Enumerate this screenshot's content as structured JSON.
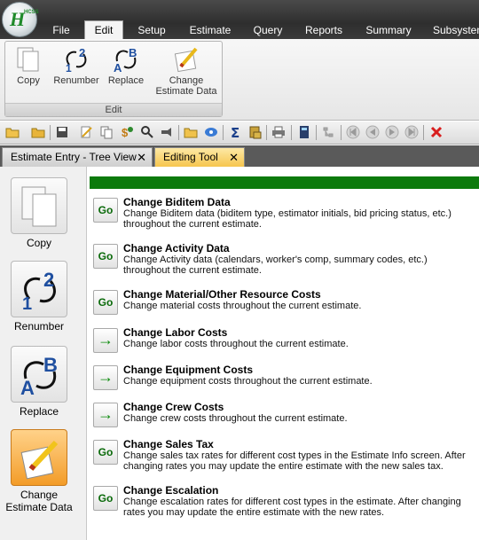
{
  "app": {
    "logo_text": "HCSS"
  },
  "menu": {
    "tabs": [
      {
        "label": "File"
      },
      {
        "label": "Edit"
      },
      {
        "label": "Setup"
      },
      {
        "label": "Estimate"
      },
      {
        "label": "Query"
      },
      {
        "label": "Reports"
      },
      {
        "label": "Summary"
      },
      {
        "label": "Subsystem"
      }
    ],
    "active_tab": "Edit"
  },
  "ribbon": {
    "group_label": "Edit",
    "buttons": [
      {
        "label": "Copy",
        "icon": "copy-icon"
      },
      {
        "label": "Renumber",
        "icon": "renumber-icon"
      },
      {
        "label": "Replace",
        "icon": "replace-icon"
      },
      {
        "label": "Change Estimate Data",
        "icon": "change-estimate-data-icon"
      }
    ]
  },
  "toolbar": {
    "icons": [
      "open-folder-icon",
      "folder-icon",
      "save-icon",
      "edit-icon",
      "copy-pages-icon",
      "price-icon",
      "search-icon",
      "flashlight-icon",
      "folder-open-icon",
      "disk-icon",
      "sum-icon",
      "calculator-stack-icon",
      "printer-icon",
      "calculator-icon",
      "tree-icon",
      "first-icon",
      "previous-icon",
      "next-icon",
      "last-icon",
      "close-red-icon"
    ]
  },
  "doc_tabs": [
    {
      "label": "Estimate Entry - Tree View",
      "active": false,
      "close": "✕"
    },
    {
      "label": "Editing Tool",
      "active": true,
      "close": "✕"
    }
  ],
  "sidebar": {
    "items": [
      {
        "label": "Copy",
        "icon": "copy-icon"
      },
      {
        "label": "Renumber",
        "icon": "renumber-icon"
      },
      {
        "label": "Replace",
        "icon": "replace-icon"
      },
      {
        "label_line1": "Change",
        "label_line2": "Estimate Data",
        "icon": "change-estimate-data-icon",
        "selected": true
      }
    ]
  },
  "tools": [
    {
      "button": "Go",
      "title": "Change Biditem Data",
      "desc": "Change Biditem data (biditem type, estimator initials, bid pricing status, etc.) throughout the current estimate."
    },
    {
      "button": "Go",
      "title": "Change Activity Data",
      "desc": "Change Activity data (calendars, worker's comp, summary codes, etc.) throughout the current estimate."
    },
    {
      "button": "Go",
      "title": "Change Material/Other Resource Costs",
      "desc": "Change material costs throughout the current estimate."
    },
    {
      "button": "→",
      "title": "Change Labor Costs",
      "desc": "Change labor costs throughout the current estimate."
    },
    {
      "button": "→",
      "title": "Change Equipment Costs",
      "desc": "Change equipment costs throughout the current estimate."
    },
    {
      "button": "→",
      "title": "Change Crew Costs",
      "desc": "Change crew costs throughout the current estimate."
    },
    {
      "button": "Go",
      "title": "Change Sales Tax",
      "desc": "Change sales tax rates for different cost types in the Estimate Info screen.  After changing rates you may update the entire estimate with the new sales tax."
    },
    {
      "button": "Go",
      "title": "Change Escalation",
      "desc": "Change escalation rates for different cost types in the estimate.  After changing rates you may update the entire estimate with the new rates."
    }
  ],
  "colors": {
    "header_green": "#0c7a0c",
    "active_tab": "#f6c54d",
    "selected_item": "#f39c28",
    "menubar": "#3a3a3a"
  }
}
